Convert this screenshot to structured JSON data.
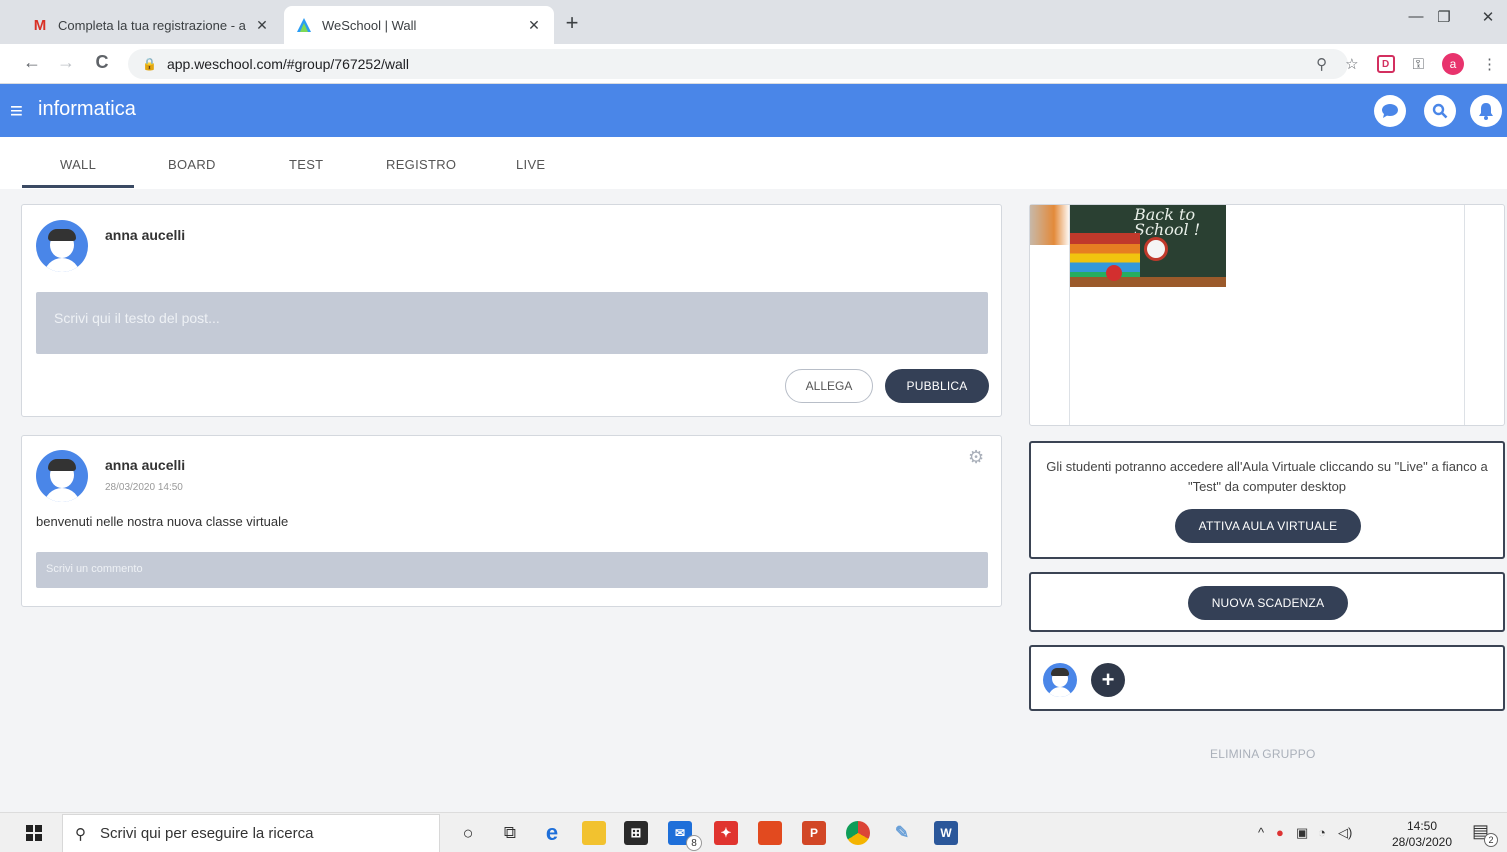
{
  "browser": {
    "tabs": [
      {
        "title": "Completa la tua registrazione - a",
        "icon": "gmail-icon",
        "close": "✕"
      },
      {
        "title": "WeSchool | Wall",
        "icon": "weschool-icon",
        "close": "✕"
      }
    ],
    "new_tab": "+",
    "url": "app.weschool.com/#group/767252/wall",
    "window_controls": {
      "minimize": "—",
      "restore": "❐",
      "close": "✕"
    },
    "nav": {
      "back": "←",
      "forward": "→",
      "reload": "C"
    },
    "profile_initial": "a",
    "extension_label": "D"
  },
  "app": {
    "group_title": "informatica",
    "menu_icon": "≡",
    "header_icons": [
      "chat-icon",
      "search-icon",
      "bell-icon"
    ],
    "nav_tabs": [
      "WALL",
      "BOARD",
      "TEST",
      "REGISTRO",
      "LIVE"
    ],
    "active_tab": "WALL",
    "accent_color": "#4a86e8",
    "dark_button_color": "#344056"
  },
  "composer": {
    "author": "anna aucelli",
    "placeholder": "Scrivi qui il testo del post...",
    "attach_label": "ALLEGA",
    "publish_label": "PUBBLICA"
  },
  "post": {
    "author": "anna aucelli",
    "timestamp": "28/03/2020 14:50",
    "text": "benvenuti nelle nostra nuova classe virtuale",
    "comment_placeholder": "Scrivi un commento"
  },
  "sidebar": {
    "cover_text": "Back to School !",
    "virtual_class_info": "Gli studenti potranno accedere all'Aula Virtuale cliccando su \"Live\" a fianco a \"Test\" da computer desktop",
    "virtual_class_button": "ATTIVA AULA VIRTUALE",
    "deadline_button": "NUOVA SCADENZA",
    "add_member_symbol": "+",
    "delete_group": "ELIMINA GRUPPO"
  },
  "taskbar": {
    "search_placeholder": "Scrivi qui per eseguire la ricerca",
    "mail_badge": "8",
    "time": "14:50",
    "date": "28/03/2020",
    "notification_count": "2"
  }
}
